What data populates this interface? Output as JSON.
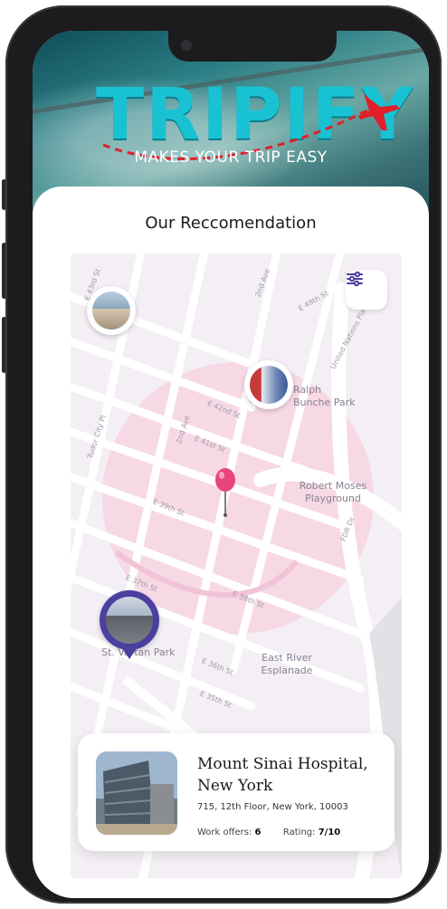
{
  "brand": {
    "logo_text": "TRIPIFY",
    "tagline": "MAKES YOUR TRIP EASY",
    "logo_color": "#19c2d3",
    "flight_path_color": "#e0202a"
  },
  "section": {
    "title": "Our Reccomendation"
  },
  "map": {
    "tint_color": "#f6d6e3",
    "accent_pin_color": "#e8457b",
    "selected_pin_color": "#4b3fa0",
    "labels": {
      "ralph_bunche": "Ralph\nBunche Park",
      "robert_moses": "Robert Moses\nPlayground",
      "st_vartan": "St. Vartan Park",
      "east_river": "East River\nEsplanade"
    },
    "streets": {
      "s1": "E 43rd St",
      "s2": "2nd Ave",
      "s3": "E 49th St",
      "s4": "United Nations Pla",
      "s5": "E 42nd St",
      "s6": "2nd Ave",
      "s7": "E 41st St",
      "s8": "Tudor City Pl",
      "s9": "E 39th St",
      "s10": "FDR Dr",
      "s11": "E 37th St",
      "s12": "E 38th St",
      "s13": "E 36th St",
      "s14": "E 35th St"
    }
  },
  "filter": {
    "icon": "sliders-icon"
  },
  "place_card": {
    "name": "Mount Sinai Hospital, New York",
    "address": "715, 12th Floor, New York, 10003",
    "work_offers_label": "Work offers:",
    "work_offers_value": "6",
    "rating_label": "Rating:",
    "rating_value": "7/10"
  }
}
